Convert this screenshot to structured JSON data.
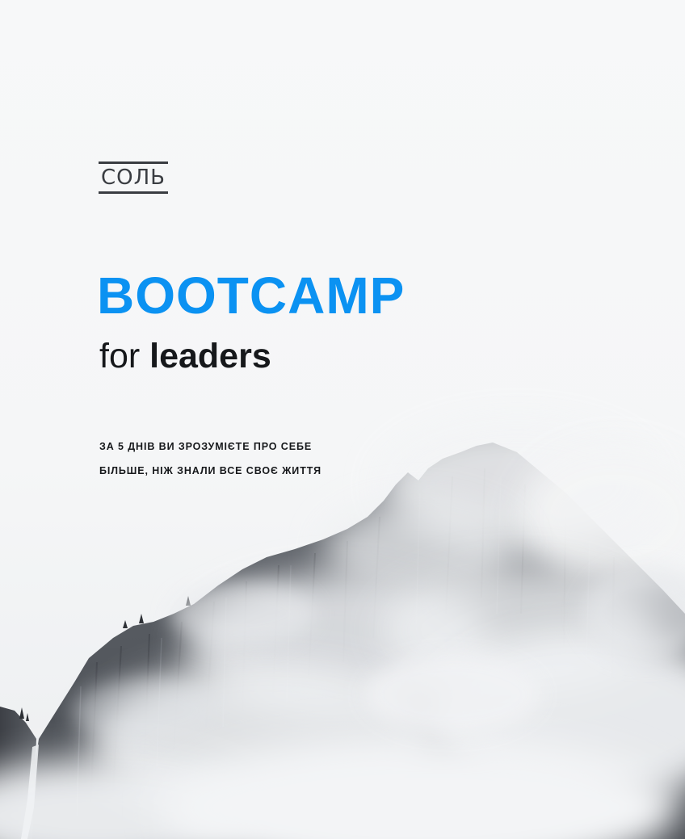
{
  "logo": {
    "text": "СОЛЬ",
    "color": "#3a3d42"
  },
  "headline": {
    "title": "BOOTCAMP",
    "title_color": "#0b92f2",
    "subtitle_prefix": "for",
    "subtitle_emphasis": "leaders"
  },
  "tagline": {
    "lines": [
      "ЗА 5 ДНІВ ВИ ЗРОЗУМІЄТЕ ПРО СЕБЕ",
      "БІЛЬШЕ, НІЖ ЗНАЛИ ВСЕ СВОЄ ЖИТТЯ"
    ]
  },
  "background": {
    "subject": "misty-mountain-photo",
    "sky_color": "#f6f7f8",
    "rock_color": "#5b5f65"
  }
}
